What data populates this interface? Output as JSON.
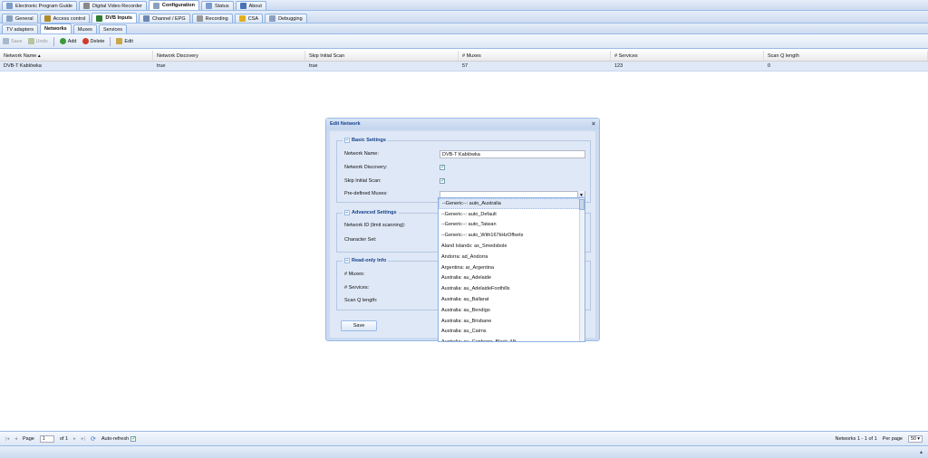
{
  "top_tabs": [
    {
      "label": "Electronic Program Guide",
      "icon": "epg-icon",
      "color": "#7b9bc9"
    },
    {
      "label": "Digital Video Recorder",
      "icon": "dvr-icon",
      "color": "#888888"
    },
    {
      "label": "Configuration",
      "icon": "wrench-icon",
      "color": "#8aa0c0",
      "active": true
    },
    {
      "label": "Status",
      "icon": "status-icon",
      "color": "#7a9bd1"
    },
    {
      "label": "About",
      "icon": "info-icon",
      "color": "#4a72b8"
    }
  ],
  "config_tabs": [
    {
      "label": "General",
      "icon": "wrench-icon",
      "color": "#8aa0c0"
    },
    {
      "label": "Access control",
      "icon": "users-icon",
      "color": "#b08a2a"
    },
    {
      "label": "DVB Inputs",
      "icon": "dvb-icon",
      "color": "#2f7d32",
      "active": true
    },
    {
      "label": "Channel / EPG",
      "icon": "channel-icon",
      "color": "#6d86b4"
    },
    {
      "label": "Recording",
      "icon": "recording-icon",
      "color": "#999999"
    },
    {
      "label": "CSA",
      "icon": "key-icon",
      "color": "#e0b020"
    },
    {
      "label": "Debugging",
      "icon": "wrench-icon",
      "color": "#8aa0c0"
    }
  ],
  "dvb_tabs": [
    {
      "label": "TV adapters"
    },
    {
      "label": "Networks",
      "active": true
    },
    {
      "label": "Muxes"
    },
    {
      "label": "Services"
    }
  ],
  "toolbar": {
    "save": "Save",
    "undo": "Undo",
    "add": "Add",
    "delete": "Delete",
    "edit": "Edit"
  },
  "grid": {
    "columns": [
      "Network Name ▴",
      "Network Discovery",
      "Skip Initial Scan",
      "# Muxes",
      "# Services",
      "Scan Q length"
    ],
    "rows": [
      [
        "DVB-T Kablówka",
        "true",
        "true",
        "57",
        "123",
        "0"
      ]
    ]
  },
  "dialog": {
    "title": "Edit Network",
    "basic_legend": "Basic Settings",
    "network_name_label": "Network Name:",
    "network_name_value": "DVB-T Kablówka",
    "network_discovery_label": "Network Discovery:",
    "skip_initial_scan_label": "Skip Initial Scan:",
    "predefined_muxes_label": "Pre-defined Muxes:",
    "advanced_legend": "Advanced Settings",
    "network_id_label": "Network ID (limit scanning):",
    "character_set_label": "Character Set:",
    "readonly_legend": "Read-only Info",
    "muxes_label": "# Muxes:",
    "services_label": "# Services:",
    "scan_q_label": "Scan Q length:",
    "save_button": "Save",
    "close": "×"
  },
  "dropdown_items": [
    "--Generic--: auto_Australia",
    "--Generic--: auto_Default",
    "--Generic--: auto_Taiwan",
    "--Generic--: auto_With167kHzOffsets",
    "Aland Islands: ax_Smedsbole",
    "Andorra: ad_Andorra",
    "Argentina: ar_Argentina",
    "Australia: au_Adelaide",
    "Australia: au_AdelaideFoothills",
    "Australia: au_Ballarat",
    "Australia: au_Bendigo",
    "Australia: au_Brisbane",
    "Australia: au_Cairns",
    "Australia: au_Canberra_Black_Mt"
  ],
  "paging": {
    "page_label": "Page",
    "page_value": "1",
    "of_label": "of 1",
    "auto_refresh": "Auto-refresh",
    "summary": "Networks 1 - 1 of 1",
    "per_page_label": "Per page",
    "per_page_value": "50"
  }
}
